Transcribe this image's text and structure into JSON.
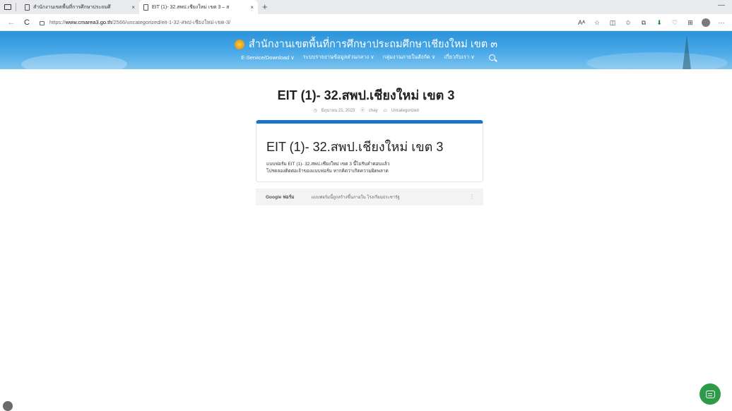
{
  "browser": {
    "tabs": [
      {
        "title": "สำนักงานเขตพื้นที่การศึกษาประถมศึ",
        "close": "×"
      },
      {
        "title": "EIT (1)- 32.สพป.เชียงใหม่ เขต 3 – ส",
        "close": "×"
      }
    ],
    "new_tab": "+",
    "minimize": "—",
    "url_prefix": "https://",
    "url_host": "www.cmarea3.go.th",
    "url_path": "/2566/uncategorized/eit-1-32-สพป-เชียงใหม่-เขต-3/",
    "back": "←",
    "reload": "C",
    "toolbar": {
      "read_aloud": "Aᴬ",
      "favorite": "☆",
      "split": "◫",
      "favorites": "✩",
      "collections": "⧉",
      "extension": "⬇",
      "browser_essentials": "♡",
      "apps": "⊞",
      "more": "···"
    }
  },
  "site": {
    "title": "สำนักงานเขตพื้นที่การศึกษาประถมศึกษาเชียงใหม่ เขต ๓",
    "nav": [
      "E-Service/Download ∨",
      "ระบบรายงานข้อมูลส่วนกลาง ∨",
      "กลุ่มงานภายในสังกัด ∨",
      "เกี่ยวกับเรา ∨"
    ]
  },
  "post": {
    "title": "EIT (1)- 32.สพป.เชียงใหม่ เขต 3",
    "date": "มิถุนายน 21, 2023",
    "author": "chay",
    "category": "Uncategorized"
  },
  "form": {
    "title": "EIT (1)- 32.สพป.เชียงใหม่ เขต 3",
    "message_line1": "แบบฟอร์ม EIT (1)- 32.สพป.เชียงใหม่ เขต 3 นี้ไม่รับคำตอบแล้ว",
    "message_line2": "โปรดลองติดต่อเจ้าของแบบฟอร์ม หากคิดว่าเกิดความผิดพลาด",
    "footer_brand": "Google ฟอร์ม",
    "footer_note": "แบบฟอร์มนี้ถูกสร้างขึ้นภายใน โรงเรียนประชารัฐ",
    "kebab": "⋮"
  },
  "colors": {
    "banner": "#2b93d9",
    "form_accent": "#1a73c8",
    "chat": "#2e9b49"
  }
}
